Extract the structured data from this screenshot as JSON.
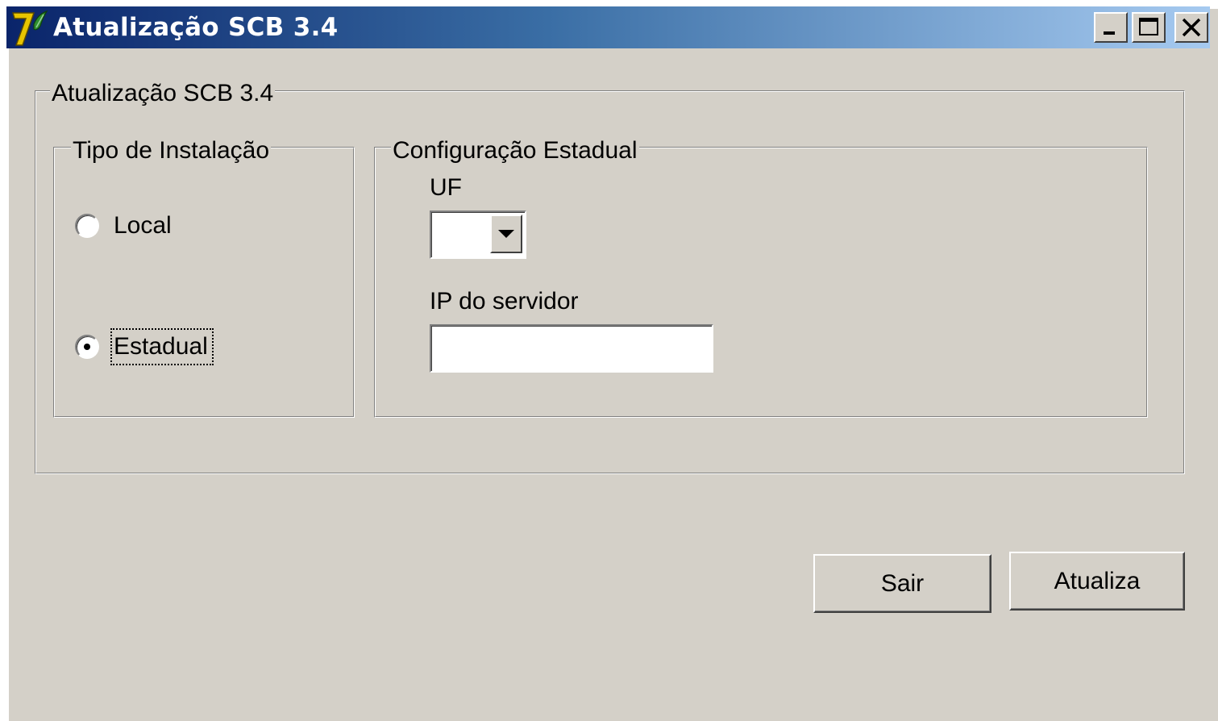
{
  "window": {
    "title": "Atualização SCB 3.4",
    "icon": "app-7-logo-icon",
    "controls": {
      "minimize": "minimize-icon",
      "maximize": "maximize-icon",
      "close": "close-icon"
    }
  },
  "main_group": {
    "legend": "Atualização SCB 3.4"
  },
  "install_type": {
    "legend": "Tipo de Instalação",
    "options": [
      {
        "label": "Local",
        "selected": false
      },
      {
        "label": "Estadual",
        "selected": true
      }
    ]
  },
  "state_config": {
    "legend": "Configuração Estadual",
    "uf_label": "UF",
    "uf_value": "",
    "ip_label": "IP do servidor",
    "ip_value": ""
  },
  "buttons": {
    "exit": "Sair",
    "update": "Atualiza"
  },
  "colors": {
    "face": "#d4d0c8",
    "title_start": "#0a246a",
    "title_end": "#a6caf0"
  }
}
